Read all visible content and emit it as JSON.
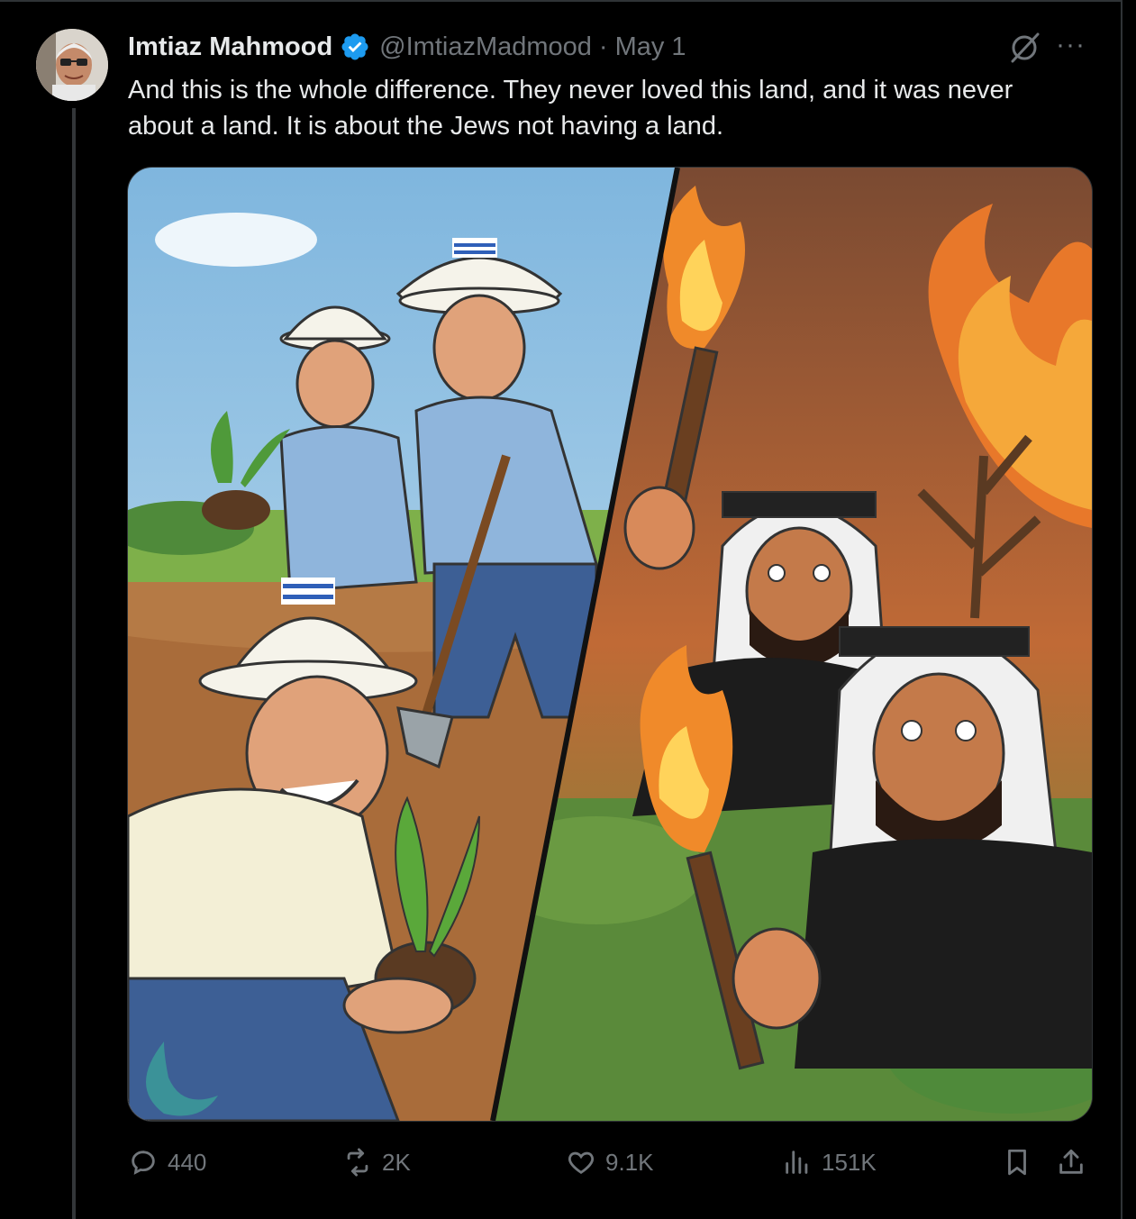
{
  "post": {
    "author_name": "Imtiaz Mahmood",
    "handle": "@ImtiazMadmood",
    "separator": "·",
    "date": "May 1",
    "text": "And this is the whole difference. They never loved this land, and it was never about a land. It is about the Jews not having a land.",
    "more_label": "···"
  },
  "actions": {
    "replies": "440",
    "reposts": "2K",
    "likes": "9.1K",
    "views": "151K"
  },
  "icons": {
    "verified": "verified-badge-icon",
    "grok": "grok-icon",
    "reply": "reply-icon",
    "repost": "repost-icon",
    "like": "heart-icon",
    "views": "views-chart-icon",
    "bookmark": "bookmark-icon",
    "share": "share-icon"
  },
  "colors": {
    "background": "#000000",
    "text": "#e7e9ea",
    "muted": "#71767b",
    "verified": "#1d9bf0"
  }
}
